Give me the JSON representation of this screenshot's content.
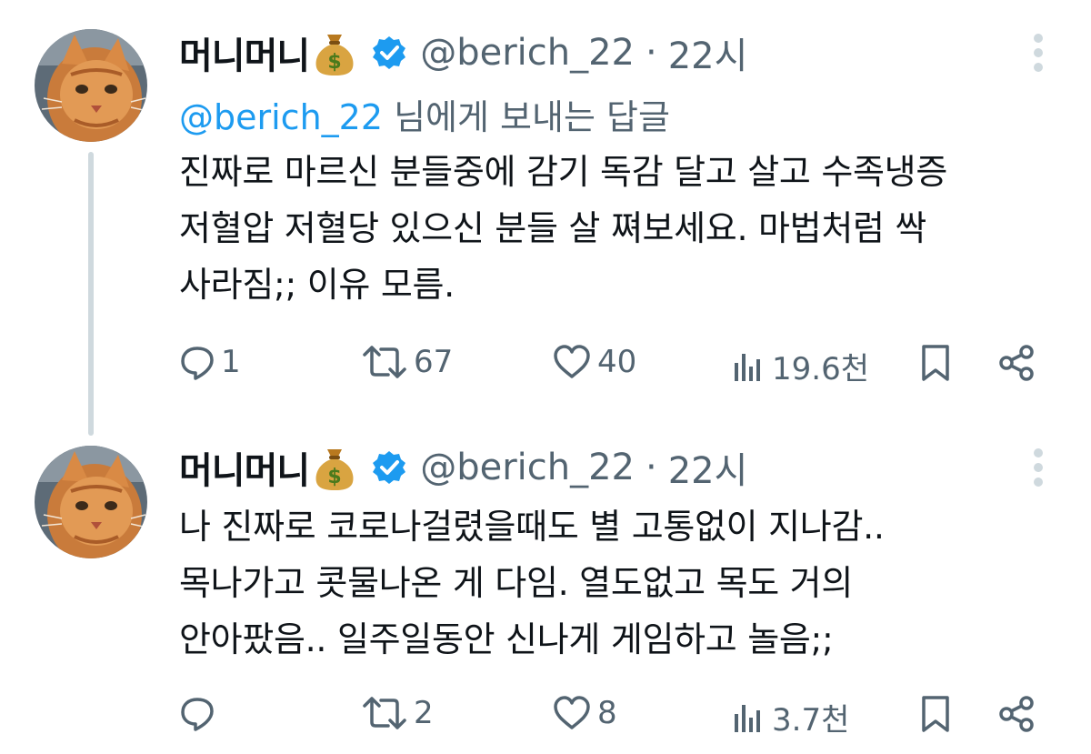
{
  "tweets": [
    {
      "author_name": "머니머니",
      "name_emoji": "moneybag-emoji",
      "handle": "@berich_22",
      "separator": "·",
      "time": "22시",
      "reply_to_mention": "@berich_22",
      "reply_to_suffix": " 님에게 보내는 답글",
      "text": "진짜로 마르신 분들중에 감기 독감 달고 살고 수족냉증\n저혈압 저혈당 있으신 분들 살 쪄보세요. 마법처럼 싹\n사라짐;; 이유 모름.",
      "replies": "1",
      "reposts": "67",
      "likes": "40",
      "views": "19.6천"
    },
    {
      "author_name": "머니머니",
      "name_emoji": "moneybag-emoji",
      "handle": "@berich_22",
      "separator": "·",
      "time": "22시",
      "text": "나 진짜로 코로나걸렸을때도 별 고통없이 지나감..\n목나가고 콧물나온 게 다임. 열도없고 목도 거의\n안아팠음.. 일주일동안 신나게 게임하고 놀음;;",
      "replies": "",
      "reposts": "2",
      "likes": "8",
      "views": "3.7천"
    }
  ],
  "colors": {
    "text": "#0f1419",
    "secondary": "#536471",
    "link": "#1d9bf0",
    "verified": "#1d9bf0",
    "thread_line": "#cfd9de"
  }
}
